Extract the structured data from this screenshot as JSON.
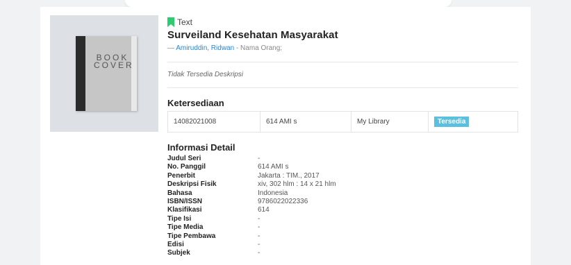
{
  "cover": {
    "label": "BOOK COVER"
  },
  "item": {
    "type": "Text",
    "title": "Surveiland Kesehatan Masyarakat",
    "author_prefix": "—",
    "author_name": "Amiruddin, Ridwan",
    "author_suffix": "- Nama Orang;",
    "description": "Tidak Tersedia Deskripsi"
  },
  "availability": {
    "heading": "Ketersediaan",
    "rows": [
      {
        "code": "14082021008",
        "call_number": "614 AMI s",
        "location": "My Library",
        "status": "Tersedia"
      }
    ]
  },
  "details": {
    "heading": "Informasi Detail",
    "rows": [
      {
        "label": "Judul Seri",
        "value": "-"
      },
      {
        "label": "No. Panggil",
        "value": "614 AMI s"
      },
      {
        "label": "Penerbit",
        "value": "Jakarta : TIM., 2017"
      },
      {
        "label": "Deskripsi Fisik",
        "value": "xiv, 302 hlm : 14 x 21 hlm"
      },
      {
        "label": "Bahasa",
        "value": "Indonesia"
      },
      {
        "label": "ISBN/ISSN",
        "value": "9786022022336"
      },
      {
        "label": "Klasifikasi",
        "value": "614"
      },
      {
        "label": "Tipe Isi",
        "value": "-"
      },
      {
        "label": "Tipe Media",
        "value": "-"
      },
      {
        "label": "Tipe Pembawa",
        "value": "-"
      },
      {
        "label": "Edisi",
        "value": "-"
      },
      {
        "label": "Subjek",
        "value": "-"
      }
    ]
  },
  "colors": {
    "accent": "#1e88e5",
    "badge": "#5bc0de",
    "bookmark": "#2ecc71"
  },
  "icons": {
    "type": "bookmark-icon"
  }
}
